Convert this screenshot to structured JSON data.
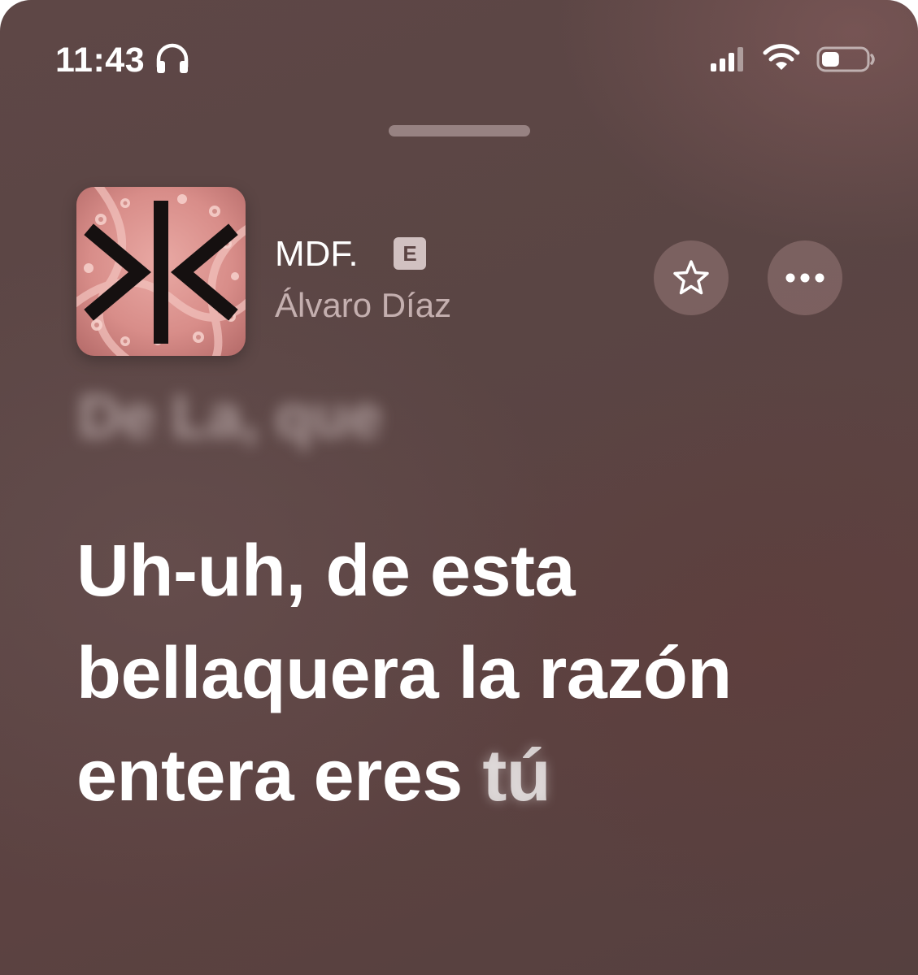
{
  "status_bar": {
    "time": "11:43",
    "headphones_icon": "headphones-icon",
    "signal_icon": "cellular-signal-icon",
    "wifi_icon": "wifi-icon",
    "battery_icon": "battery-icon",
    "battery_level": 0.4
  },
  "now_playing": {
    "title": "MDF.",
    "explicit_badge": "E",
    "artist": "Álvaro Díaz",
    "favorite_icon": "star-outline-icon",
    "more_icon": "ellipsis-icon"
  },
  "lyrics": {
    "previous_line": "De La, que",
    "current_line_sung": "Uh-uh, de esta bellaquera la razón entera eres ",
    "current_line_upcoming": "tú"
  },
  "colors": {
    "background": "#5c4544",
    "text_primary": "#ffffff",
    "text_secondary": "#dcc8c8",
    "button_fill": "#8a6a6a"
  }
}
